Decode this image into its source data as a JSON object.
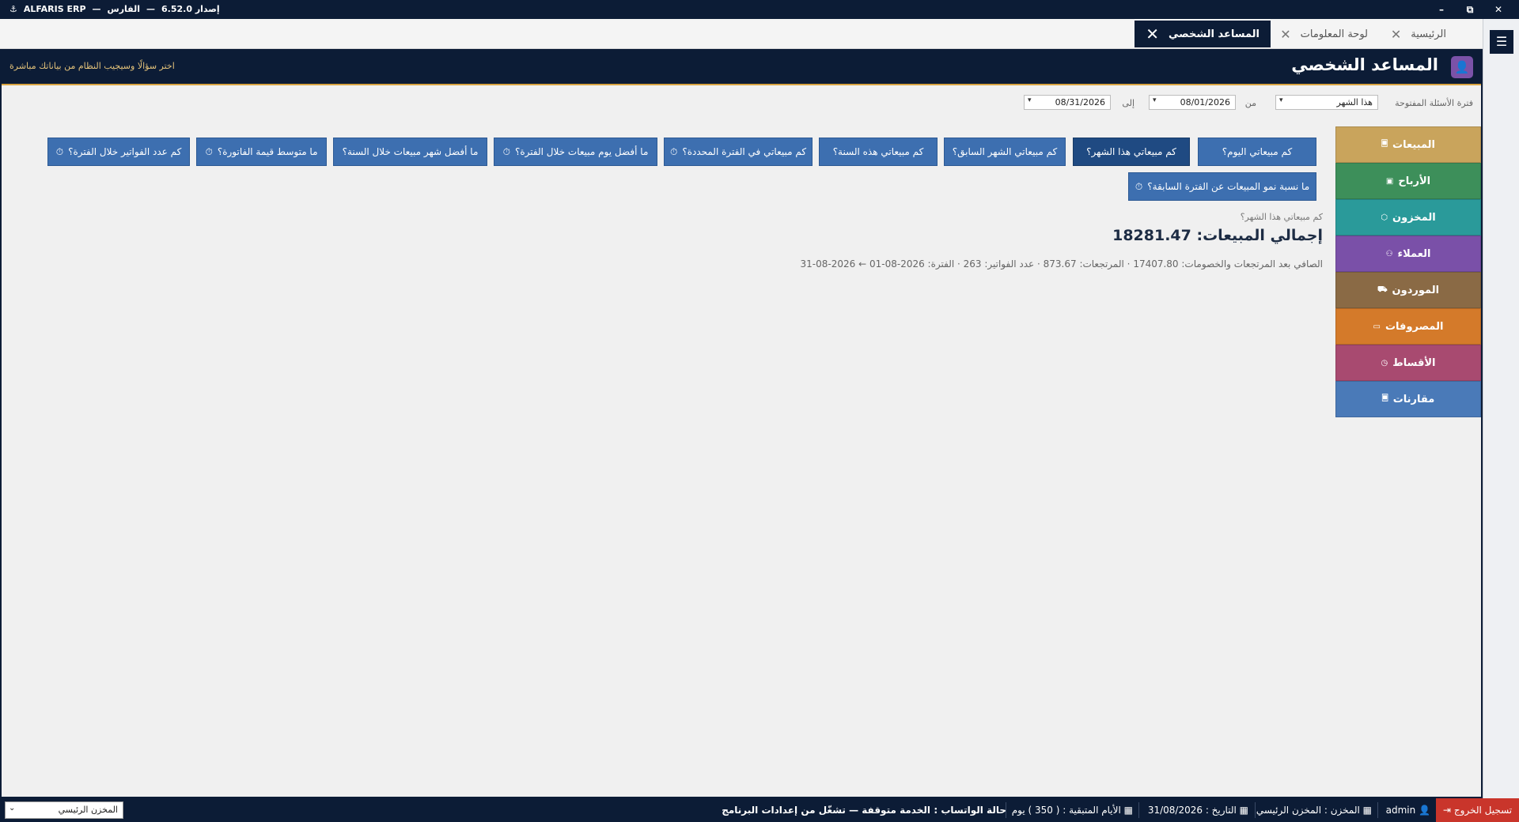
{
  "titlebar": {
    "app_name": "ALFARIS ERP",
    "sep1": "—",
    "product": "الفارس",
    "sep2": "—",
    "version": "إصدار 6.52.0",
    "minimize": "–",
    "restore": "⧉",
    "close": "✕"
  },
  "tabs": [
    {
      "label": "الرئيسية",
      "close": "✕"
    },
    {
      "label": "لوحة المعلومات",
      "close": "✕"
    },
    {
      "label": "المساعد الشخصي",
      "close": "✕"
    }
  ],
  "menu_icon": "☰",
  "header": {
    "title": "المساعد الشخصي",
    "hint": "اختر سؤالًا وسيجيب النظام من بياناتك مباشرة",
    "avatar_icon": "user-icon",
    "avatar_glyph": "👤"
  },
  "filters": {
    "period_label": "فترة الأسئلة المفتوحة",
    "period_value": "هذا الشهر",
    "from_label": "من",
    "from_value": "08/01/2026",
    "to_label": "إلى",
    "to_value": "08/31/2026",
    "arrow": "▾"
  },
  "questions": [
    {
      "label": "كم مبيعاتي اليوم؟",
      "icon": ""
    },
    {
      "label": "كم مبيعاتي هذا الشهر؟",
      "icon": ""
    },
    {
      "label": "كم مبيعاتي الشهر السابق؟",
      "icon": ""
    },
    {
      "label": "كم مبيعاتي هذه السنة؟",
      "icon": ""
    },
    {
      "label": "كم مبيعاتي في الفترة المحددة؟",
      "icon": "⏱"
    },
    {
      "label": "ما أفضل يوم مبيعات خلال الفترة؟",
      "icon": "⏱"
    },
    {
      "label": "ما أفضل شهر مبيعات خلال السنة؟",
      "icon": ""
    },
    {
      "label": "ما متوسط قيمة الفاتورة؟",
      "icon": "⏱"
    },
    {
      "label": "كم عدد الفواتير خلال الفترة؟",
      "icon": "⏱"
    },
    {
      "label": "ما نسبة نمو المبيعات عن الفترة السابقة؟",
      "icon": "⏱"
    }
  ],
  "result": {
    "question": "كم مبيعاتي هذا الشهر؟",
    "total": "إجمالي المبيعات: 18281.47",
    "detail": "الصافي بعد المرتجعات والخصومات: 17407.80 · المرتجعات: 873.67 · عدد الفواتير: 263 · الفترة: 2026-08-01 ← 2026-08-31"
  },
  "categories": [
    {
      "label": "المبيعات",
      "icon": "🗏",
      "color": "#c9a45c"
    },
    {
      "label": "الأرباح",
      "icon": "▣",
      "color": "#3d8f5a"
    },
    {
      "label": "المخزون",
      "icon": "⬡",
      "color": "#2a9a9a"
    },
    {
      "label": "العملاء",
      "icon": "⚇",
      "color": "#7a50a8"
    },
    {
      "label": "الموردون",
      "icon": "⛟",
      "color": "#8a6a45"
    },
    {
      "label": "المصروفات",
      "icon": "▭",
      "color": "#d47a2a"
    },
    {
      "label": "الأقساط",
      "icon": "◷",
      "color": "#a84a70"
    },
    {
      "label": "مقارنات",
      "icon": "🗏",
      "color": "#4a7ab8"
    }
  ],
  "statusbar": {
    "logout": "تسجيل الخروج",
    "user": "admin",
    "warehouse": "المخزن : المخزن الرئيسي",
    "date": "التاريخ : 31/08/2026",
    "days_left": "الأيام المتبقية : ( 350 ) يوم",
    "whatsapp_label": "حالة الواتساب :",
    "whatsapp_status": "الخدمة متوقفة — تشغّل من إعدادات البرنامج",
    "warehouse_select": "المخزن الرئيسي"
  }
}
